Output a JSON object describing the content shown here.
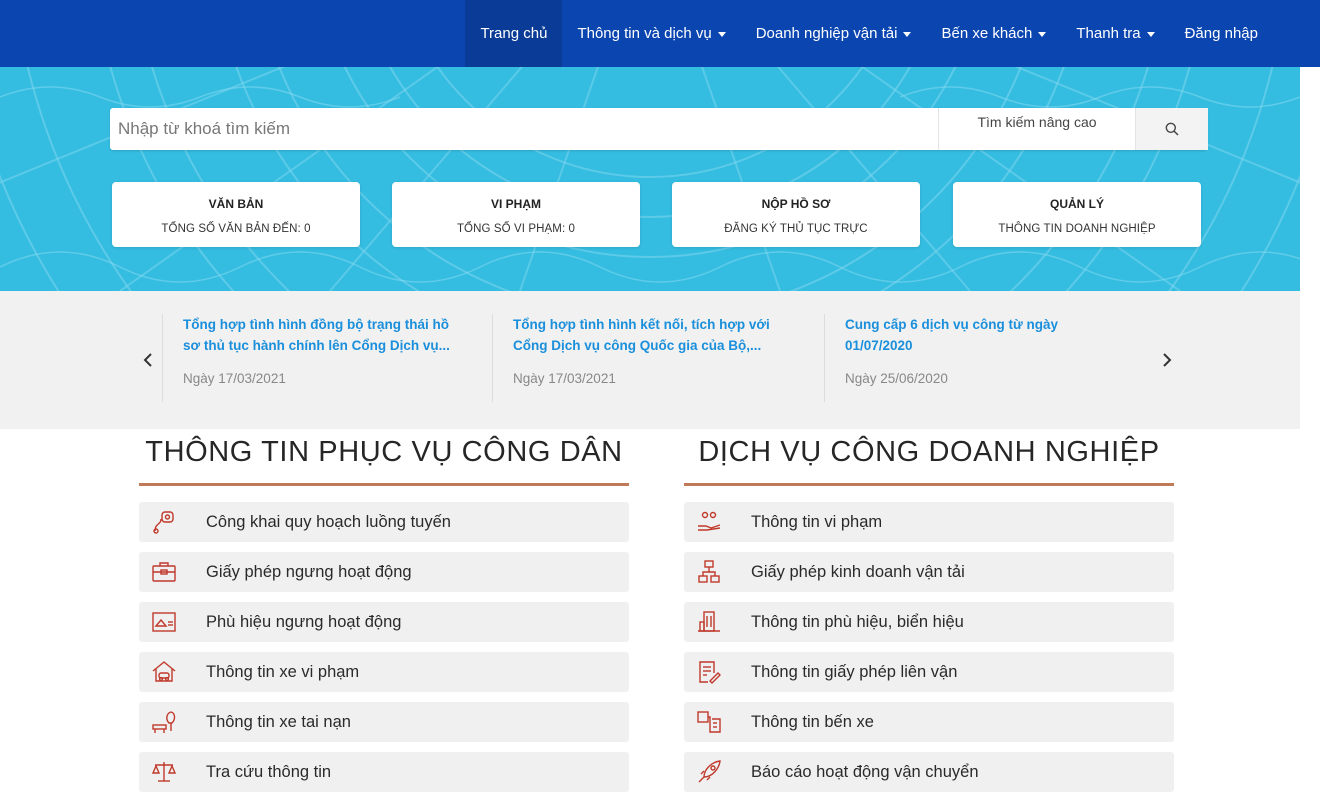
{
  "nav": {
    "items": [
      {
        "label": "Trang chủ"
      },
      {
        "label": "Thông tin và dịch vụ"
      },
      {
        "label": "Doanh nghiệp vận tải"
      },
      {
        "label": "Bến xe khách"
      },
      {
        "label": "Thanh tra"
      },
      {
        "label": "Đăng nhập"
      }
    ]
  },
  "search": {
    "placeholder": "Nhập từ khoá tìm kiếm",
    "advanced_label": "Tìm kiếm nâng cao"
  },
  "stats": [
    {
      "title": "VĂN BẢN",
      "subtitle": "TỔNG SỐ VĂN BẢN ĐẾN: 0"
    },
    {
      "title": "VI PHẠM",
      "subtitle": "TỔNG SỐ VI PHẠM: 0"
    },
    {
      "title": "NỘP HỒ SƠ",
      "subtitle": "ĐĂNG KÝ THỦ TỤC TRỰC"
    },
    {
      "title": "QUẢN LÝ",
      "subtitle": "THÔNG TIN DOANH NGHIỆP"
    }
  ],
  "news": [
    {
      "title": "Tổng hợp tình hình đồng bộ trạng thái hồ sơ thủ tục hành chính lên Cổng Dịch vụ...",
      "date": "Ngày 17/03/2021"
    },
    {
      "title": "Tổng hợp tình hình kết nối, tích hợp với Cổng Dịch vụ công Quốc gia của Bộ,...",
      "date": "Ngày 17/03/2021"
    },
    {
      "title": "Cung cấp 6 dịch vụ công từ ngày 01/07/2020",
      "date": "Ngày 25/06/2020"
    }
  ],
  "citizen": {
    "title": "THÔNG TIN PHỤC VỤ CÔNG DÂN",
    "items": [
      {
        "label": "Công khai quy hoạch luồng tuyến",
        "icon": "route-planning-icon"
      },
      {
        "label": "Giấy phép ngưng hoạt động",
        "icon": "briefcase-icon"
      },
      {
        "label": "Phù hiệu ngưng hoạt động",
        "icon": "badge-card-icon"
      },
      {
        "label": "Thông tin xe vi phạm",
        "icon": "garage-icon"
      },
      {
        "label": "Thông tin xe tai nạn",
        "icon": "accident-icon"
      },
      {
        "label": "Tra cứu thông tin",
        "icon": "scales-icon"
      }
    ]
  },
  "business": {
    "title": "DỊCH VỤ CÔNG DOANH NGHIỆP",
    "items": [
      {
        "label": "Thông tin vi phạm",
        "icon": "hand-people-icon"
      },
      {
        "label": "Giấy phép kinh doanh vận tải",
        "icon": "hierarchy-icon"
      },
      {
        "label": "Thông tin phù hiệu, biển hiệu",
        "icon": "building-icon"
      },
      {
        "label": "Thông tin giấy phép liên vận",
        "icon": "document-edit-icon"
      },
      {
        "label": "Thông tin bến xe",
        "icon": "station-icon"
      },
      {
        "label": "Báo cáo hoạt động vận chuyển",
        "icon": "rocket-icon"
      }
    ]
  },
  "colors": {
    "navbar": "#0b45b0",
    "hero": "#34bde1",
    "news_link": "#1a8fdb",
    "section_line": "#c07a58",
    "icon": "#c0392b"
  }
}
